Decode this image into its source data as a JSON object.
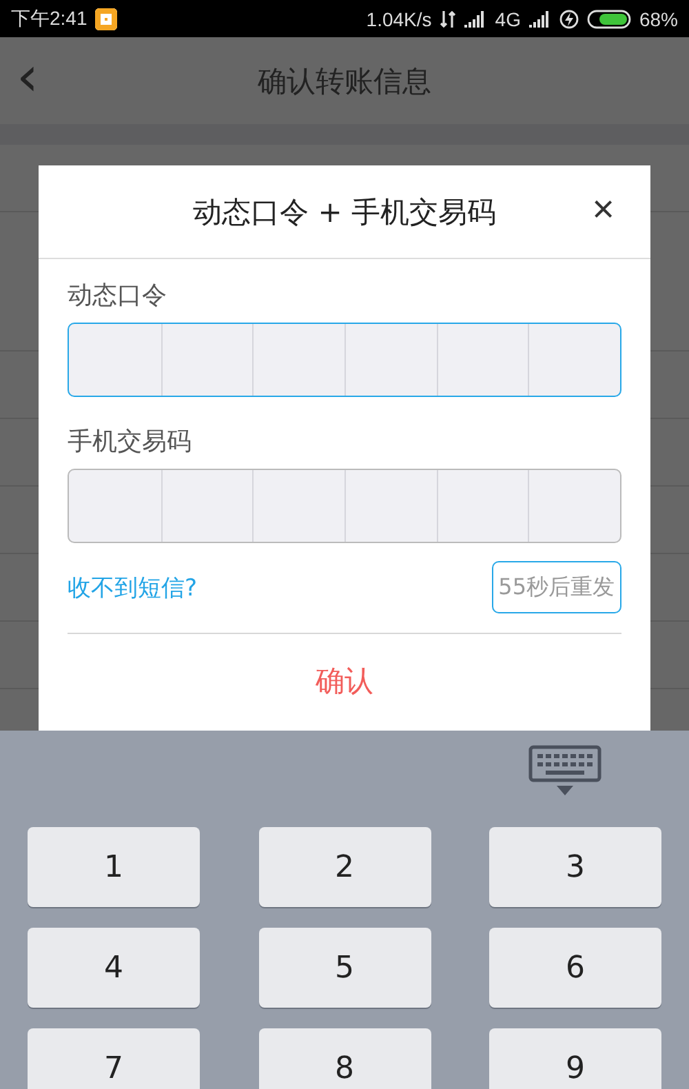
{
  "status_bar": {
    "time": "下午2:41",
    "network_speed": "1.04K/s",
    "network_type": "4G",
    "battery": "68%"
  },
  "header": {
    "back": "‹",
    "title": "确认转账信息"
  },
  "dialog": {
    "title": "动态口令 + 手机交易码",
    "close": "×",
    "fields": [
      {
        "label": "动态口令",
        "focused": true
      },
      {
        "label": "手机交易码",
        "focused": false
      }
    ],
    "help_link": "收不到短信?",
    "resend_button": {
      "label": "55秒后重发",
      "disabled": true
    },
    "confirm_button": "确认"
  },
  "keypad": {
    "keys": [
      "1",
      "2",
      "3",
      "4",
      "5",
      "6",
      "7",
      "8",
      "9"
    ]
  }
}
